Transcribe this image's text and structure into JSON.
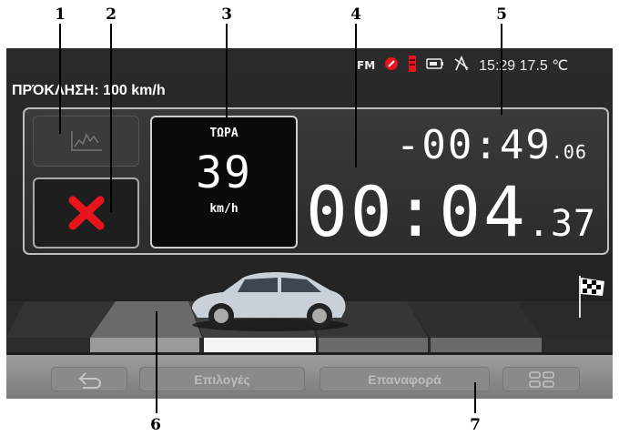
{
  "callouts": [
    "1",
    "2",
    "3",
    "4",
    "5",
    "6",
    "7"
  ],
  "status_bar": {
    "radio": "FM",
    "time": "15:29",
    "temperature": "17.5 ℃",
    "icons": [
      "compass-icon",
      "battery-level-icon",
      "card-icon",
      "gps-satellite-icon"
    ]
  },
  "challenge": "ΠΡΌΚΛΗΣΗ: 100 km/h",
  "speed": {
    "label": "ΤΩΡΑ",
    "value": "39",
    "unit": "km/h"
  },
  "difference": {
    "main": "-00:49",
    "fraction": ".06"
  },
  "timer": {
    "main": "00:04",
    "fraction": ".37"
  },
  "toolbar": {
    "back_icon": "back-icon",
    "options": "Επιλογές",
    "reset": "Επαναφορά",
    "menu_icon": "grid-menu-icon"
  },
  "colors": {
    "accent_red": "#e8141c",
    "background": "#262626",
    "toolbar": "#8c8c8c"
  }
}
